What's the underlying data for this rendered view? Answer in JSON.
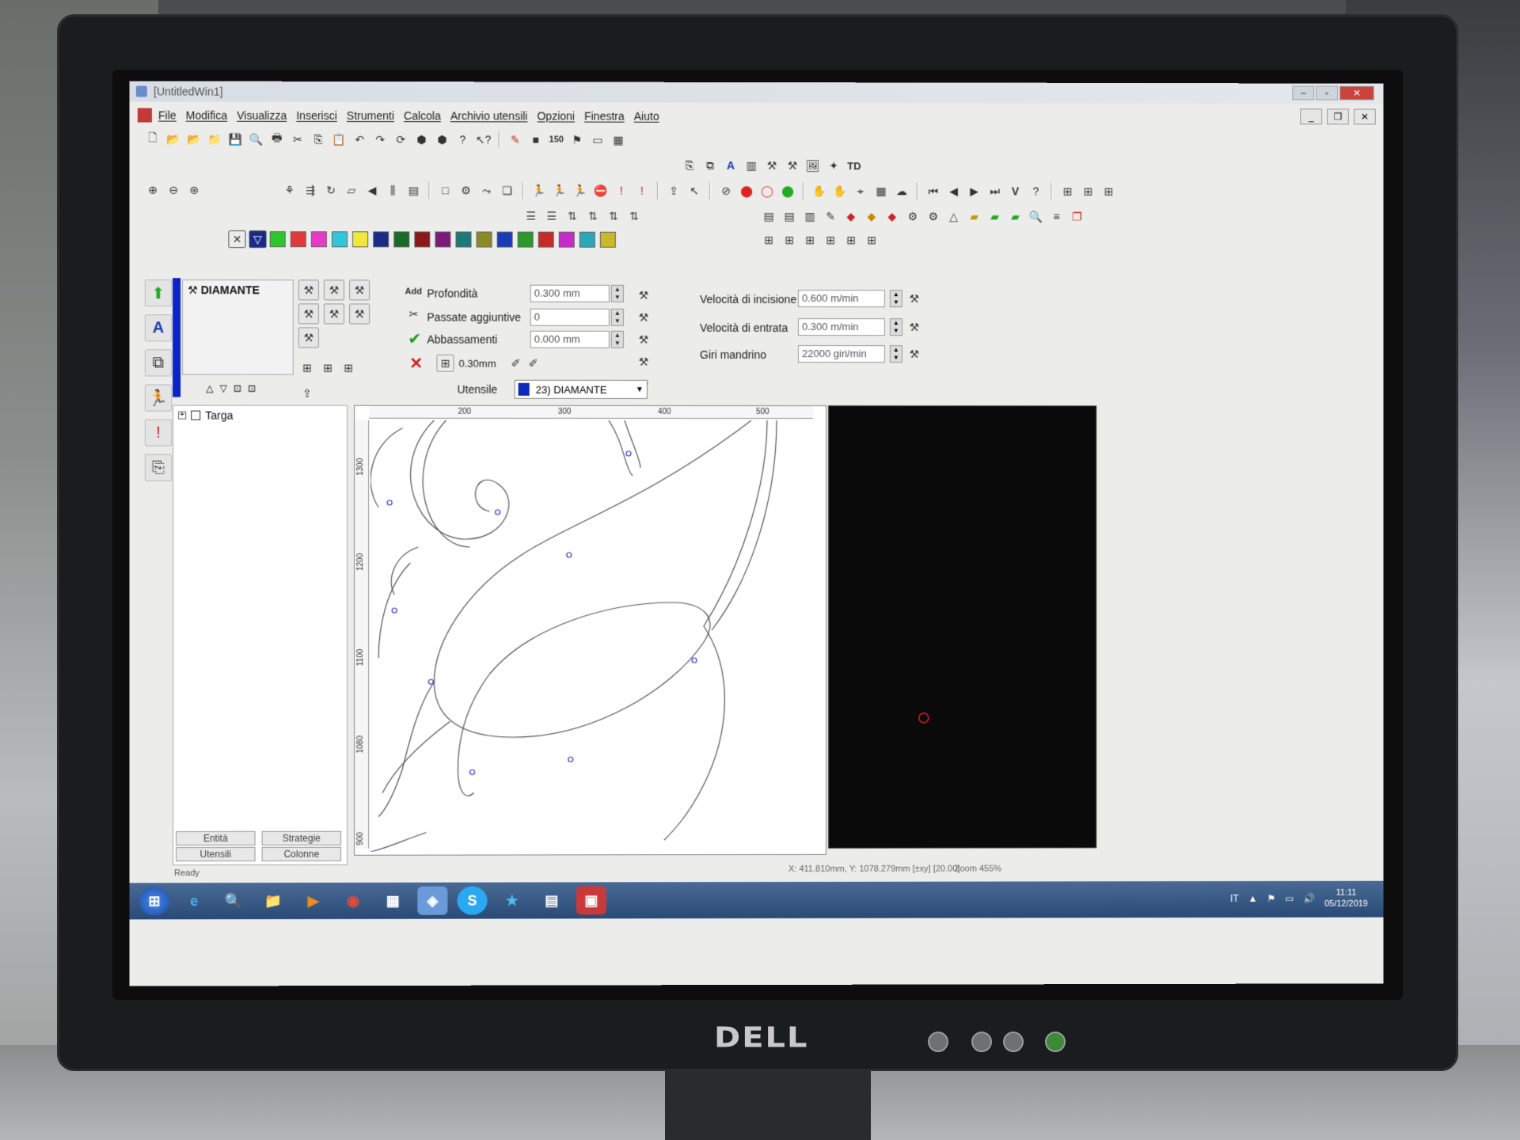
{
  "window": {
    "title": "[UntitledWin1]"
  },
  "menu": [
    "File",
    "Modifica",
    "Visualizza",
    "Inserisci",
    "Strumenti",
    "Calcola",
    "Archivio utensili",
    "Opzioni",
    "Finestra",
    "Aiuto"
  ],
  "toolbar_td_label": "TD",
  "toolbar_150_label": "150",
  "palette_colors": [
    "#2ec52e",
    "#e23a3a",
    "#e83ac8",
    "#2ec8d8",
    "#f0e83a",
    "#1a2a8a",
    "#1a6a2a",
    "#8a1a1a",
    "#7a1a7a",
    "#1a7a7a",
    "#8a8a2a",
    "#1a3ab8",
    "#2a9a2a",
    "#c82a2a",
    "#c82ac8",
    "#2aa8b8",
    "#c8b82a"
  ],
  "tool_panel": {
    "tool_name": "DIAMANTE",
    "profondita_label": "Profondità",
    "profondita_value": "0.300 mm",
    "passate_label": "Passate aggiuntive",
    "passate_value": "0",
    "abbassamenti_label": "Abbassamenti",
    "abbassamenti_value": "0.000 mm",
    "offset_value": "0.30mm",
    "vel_incisione_label": "Velocità di incisione",
    "vel_incisione_value": "0.600 m/min",
    "vel_entrata_label": "Velocità di entrata",
    "vel_entrata_value": "0.300 m/min",
    "giri_label": "Giri mandrino",
    "giri_value": "22000 giri/min",
    "utensile_label": "Utensile",
    "utensile_value": "23) DIAMANTE"
  },
  "tree": {
    "root": "Targa"
  },
  "bottom_tabs": {
    "entita": "Entità",
    "strategie": "Strategie",
    "utensili": "Utensili",
    "colonne": "Colonne"
  },
  "ruler": {
    "h_ticks": [
      "200",
      "300",
      "400",
      "500"
    ],
    "v_ticks": [
      "1300",
      "1200",
      "1100",
      "1080",
      "900"
    ]
  },
  "status": {
    "ready": "Ready",
    "coords": "X: 411.810mm, Y: 1078.279mm [±xy] [20.00]",
    "zoom_label": "Zoom",
    "zoom_value": "455%"
  },
  "tray": {
    "lang": "IT",
    "time": "11:11",
    "date": "05/12/2019"
  },
  "monitor_brand": "DELL"
}
